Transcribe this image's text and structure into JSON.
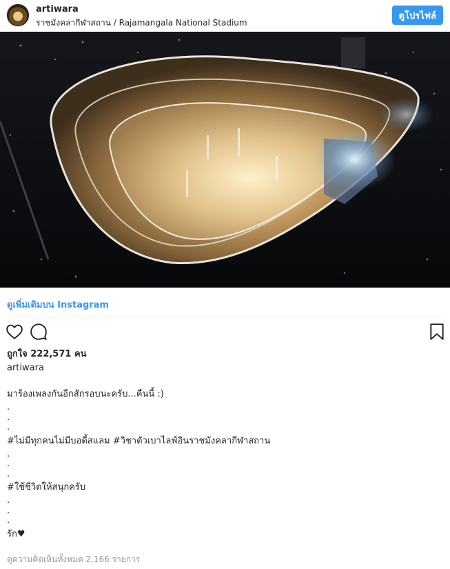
{
  "header": {
    "username": "artiwara",
    "location": "ราชมังคลากีฬาสถาน / Rajamangala National Stadium",
    "profile_button": "ดูโปรไฟล์"
  },
  "post": {
    "more_link": "ดูเพิ่มเติมบน Instagram",
    "likes": "ถูกใจ 222,571 คน",
    "caption_user": "artiwara",
    "caption_lines": [
      "มาร้องเพลงกันอีกสักรอบนะครับ...คืนนี้ :)",
      ".",
      ".",
      ".",
      "#ไม่มีทุกคนไม่มีบอดี้สแลม #วิชาตัวเบาไลฟ์อินราชมังคลากีฬาสถาน",
      ".",
      ".",
      ".",
      "#ใช้ชีวิตให้สนุกครับ",
      ".",
      ".",
      ".",
      "รัก♥"
    ],
    "comments_link": "ดูความคิดเห็นทั้งหมด 2,166 รายการ"
  },
  "icons": {
    "like": "heart-icon",
    "comment": "comment-icon",
    "save": "bookmark-icon"
  },
  "colors": {
    "accent": "#3897f0",
    "text": "#262626",
    "muted": "#999999"
  }
}
